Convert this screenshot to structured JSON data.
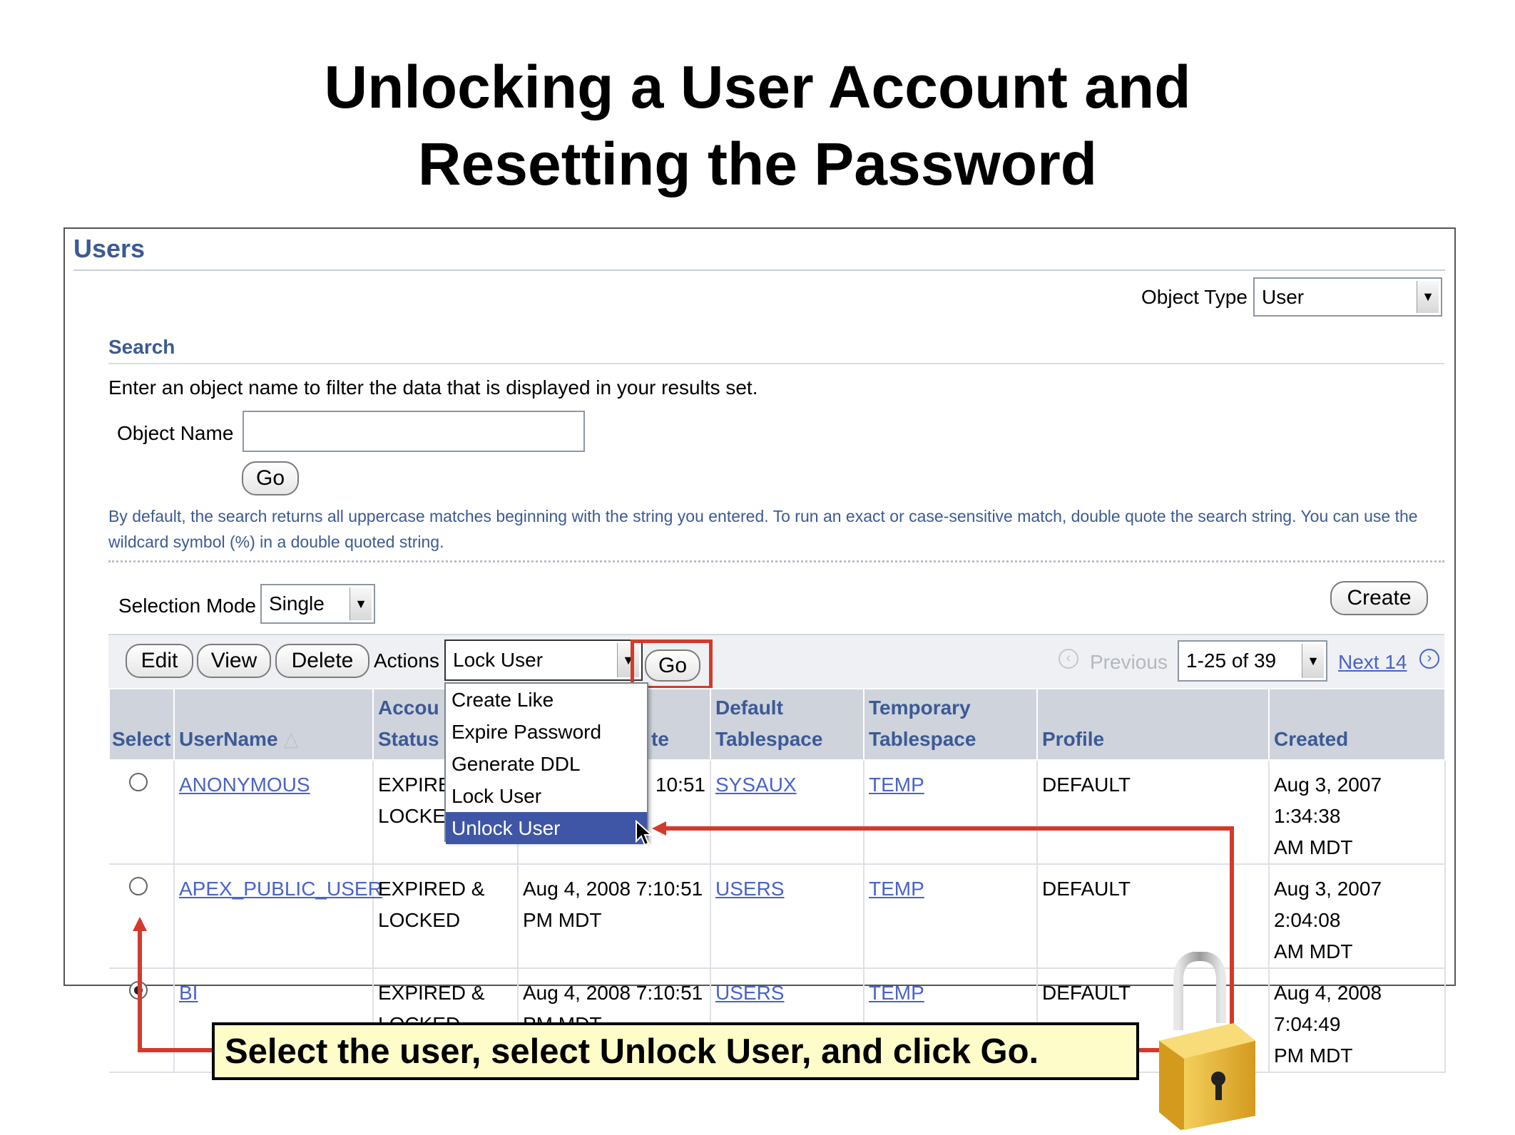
{
  "slide": {
    "title_line1": "Unlocking a User Account and",
    "title_line2": "Resetting the Password"
  },
  "header": {
    "title": "Users",
    "object_type_label": "Object Type",
    "object_type_value": "User"
  },
  "search": {
    "title": "Search",
    "instructions": "Enter an object name to filter the data that is displayed in your results set.",
    "object_name_label": "Object Name",
    "object_name_value": "",
    "go_label": "Go",
    "hint": "By default, the search returns all uppercase matches beginning with the string you entered. To run an exact or case-sensitive match, double quote the search string. You can use the wildcard symbol (%) in a double quoted string."
  },
  "selection": {
    "mode_label": "Selection Mode",
    "mode_value": "Single",
    "create_label": "Create"
  },
  "toolbar": {
    "edit_label": "Edit",
    "view_label": "View",
    "delete_label": "Delete",
    "actions_label": "Actions",
    "actions_value": "Lock User",
    "go_label": "Go",
    "previous_label": "Previous",
    "range_value": "1-25 of 39",
    "next_label": "Next 14"
  },
  "actions_menu": [
    "Create Like",
    "Expire Password",
    "Generate DDL",
    "Lock User",
    "Unlock User"
  ],
  "table": {
    "headers": {
      "select": "Select",
      "username": "UserName",
      "account_status_1": "Accou",
      "account_status_2": "Status",
      "expire_fragment": "te",
      "default_ts_1": "Default",
      "default_ts_2": "Tablespace",
      "temp_ts_1": "Temporary",
      "temp_ts_2": "Tablespace",
      "profile": "Profile",
      "created": "Created"
    },
    "rows": [
      {
        "username": "ANONYMOUS",
        "status_1": "EXPIRE",
        "status_2": "LOCKE",
        "expire_1": "10:51",
        "expire_2": "",
        "default_ts": "SYSAUX",
        "temp_ts": "TEMP",
        "profile": "DEFAULT",
        "created_1": "Aug 3, 2007 1:34:38",
        "created_2": "AM MDT"
      },
      {
        "username": "APEX_PUBLIC_USER",
        "status_1": "EXPIRED &",
        "status_2": "LOCKED",
        "expire_1": "Aug 4, 2008 7:10:51",
        "expire_2": "PM MDT",
        "default_ts": "USERS",
        "temp_ts": "TEMP",
        "profile": "DEFAULT",
        "created_1": "Aug 3, 2007 2:04:08",
        "created_2": "AM MDT"
      },
      {
        "username": "BI",
        "status_1": "EXPIRED &",
        "status_2": "LOCKED",
        "expire_1": "Aug 4, 2008 7:10:51",
        "expire_2": "PM MDT",
        "default_ts": "USERS",
        "temp_ts": "TEMP",
        "profile": "DEFAULT",
        "created_1": "Aug 4, 2008 7:04:49",
        "created_2": "PM MDT"
      }
    ]
  },
  "callout": {
    "text": "Select the user, select Unlock User, and click Go."
  },
  "colors": {
    "accent": "#3c5a93",
    "highlight": "#3f56a6",
    "callout_line": "#d33a2c",
    "callout_bg": "#fefcc9",
    "lock_gold": "#e6b43c"
  },
  "icons": [
    "chevron-down-icon",
    "previous-icon",
    "next-icon",
    "sort-icon",
    "mouse-cursor-icon",
    "padlock-icon"
  ]
}
